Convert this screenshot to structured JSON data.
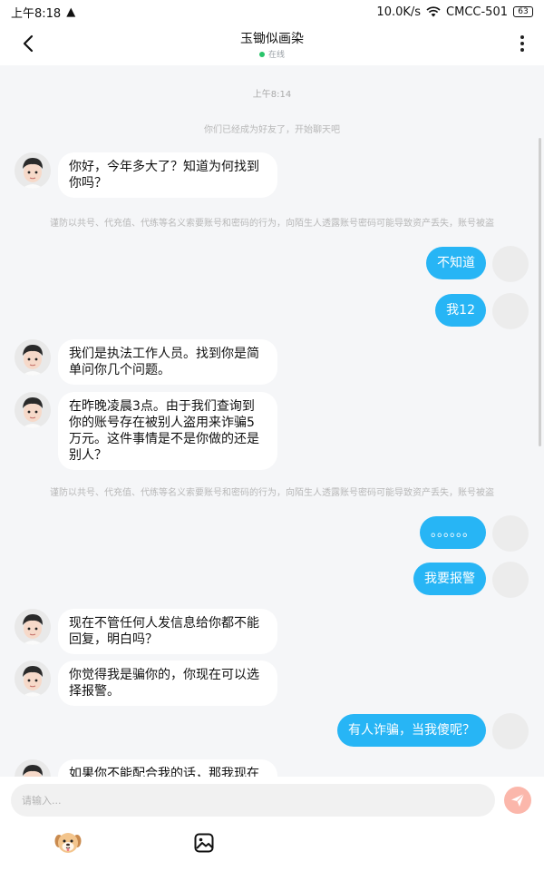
{
  "status_bar": {
    "time": "上午8:18",
    "warning_icon": "warning-icon",
    "speed": "10.0K/s",
    "carrier": "CMCC-501",
    "battery": "63"
  },
  "header": {
    "title": "玉锄似画染",
    "status": "在线",
    "back_icon": "back-arrow-icon",
    "more_icon": "more-vertical-icon"
  },
  "chat": {
    "timestamp": "上午8:14",
    "friend_notice": "你们已经成为好友了，开始聊天吧",
    "warning_text": "谨防以共号、代充值、代练等名义索要账号和密码的行为，向陌生人透露账号密码可能导致资产丢失，账号被盗",
    "messages": [
      {
        "side": "left",
        "text": "你好，今年多大了？知道为何找到你吗？"
      },
      {
        "side": "right",
        "text": "不知道"
      },
      {
        "side": "right",
        "text": "我12"
      },
      {
        "side": "left",
        "text": "我们是执法工作人员。找到你是简单问你几个问题。"
      },
      {
        "side": "left",
        "text": "在昨晚凌晨3点。由于我们查询到你的账号存在被别人盗用来诈骗5万元。这件事情是不是你做的还是别人？"
      },
      {
        "side": "right",
        "text": "。。。。。。"
      },
      {
        "side": "right",
        "text": "我要报警"
      },
      {
        "side": "left",
        "text": "现在不管任何人发信息给你都不能回复，明白吗？"
      },
      {
        "side": "left",
        "text": "你觉得我是骗你的，你现在可以选择报警。"
      },
      {
        "side": "right",
        "text": "有人诈骗，当我傻呢？"
      },
      {
        "side": "left",
        "text": "如果你不能配合我的话，那我现在联"
      }
    ]
  },
  "input": {
    "placeholder": "请输入...",
    "send_icon": "send-icon",
    "emoji_icon": "dog-emoji-icon",
    "image_icon": "image-icon"
  },
  "colors": {
    "my_bubble": "#27b5f5",
    "other_bubble": "#ffffff",
    "online": "#29c46a",
    "send_button": "#fbb7ab"
  }
}
